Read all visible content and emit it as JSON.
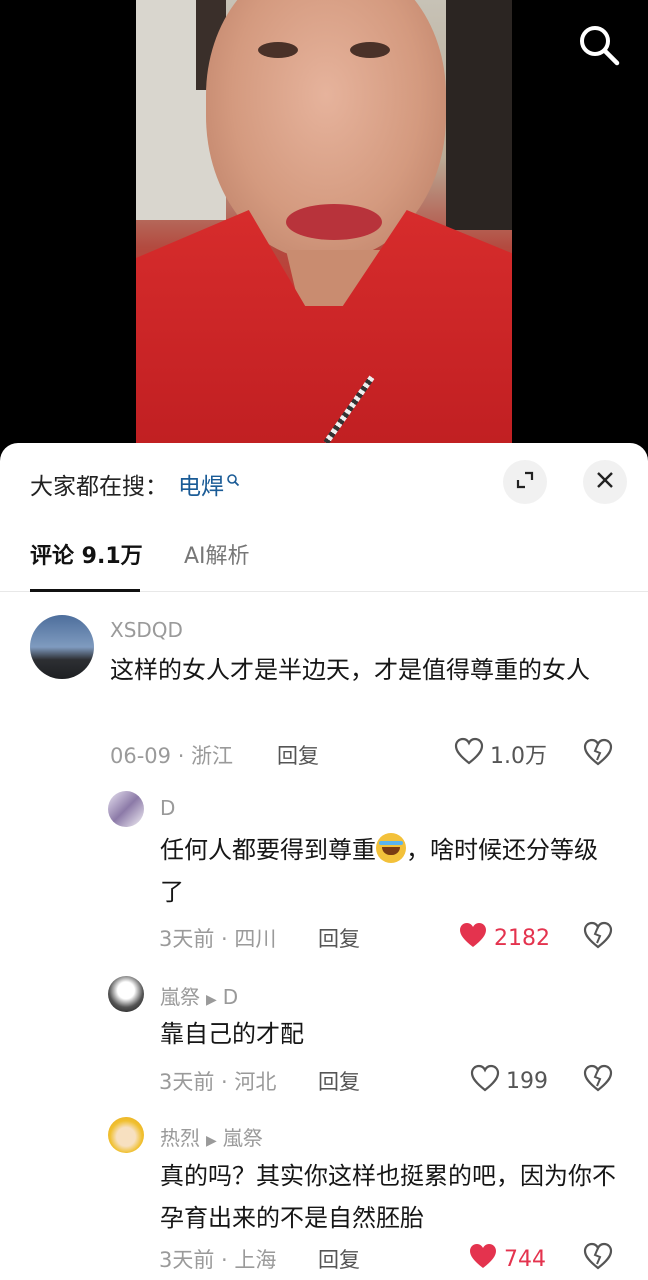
{
  "sheet": {
    "search_prefix": "大家都在搜：",
    "search_term": "电焊",
    "tabs": {
      "comments": "评论 9.1万",
      "ai": "AI解析"
    }
  },
  "comments": [
    {
      "user": "XSDQD",
      "text": "这样的女人才是半边天，才是值得尊重的女人",
      "meta": "06-09 · 浙江",
      "reply": "回复",
      "likes": "1.0万",
      "liked": false
    },
    {
      "user": "D",
      "text_before": "任何人都要得到尊重",
      "emoji": "crying-laughing-emoji",
      "text_after": "，啥时候还分等级了",
      "meta": "3天前 · 四川",
      "reply": "回复",
      "likes": "2182",
      "liked": true
    },
    {
      "user": "嵐祭",
      "reply_to": "D",
      "text": "靠自己的才配",
      "meta": "3天前 · 河北",
      "reply": "回复",
      "likes": "199",
      "liked": false
    },
    {
      "user": "热烈",
      "reply_to": "嵐祭",
      "text": "真的吗？其实你这样也挺累的吧，因为你不孕育出来的不是自然胚胎",
      "meta": "3天前 · 上海",
      "reply": "回复",
      "likes": "744",
      "liked": true
    }
  ],
  "colors": {
    "liked": "#e4334e",
    "search_term": "#1a5b96"
  }
}
